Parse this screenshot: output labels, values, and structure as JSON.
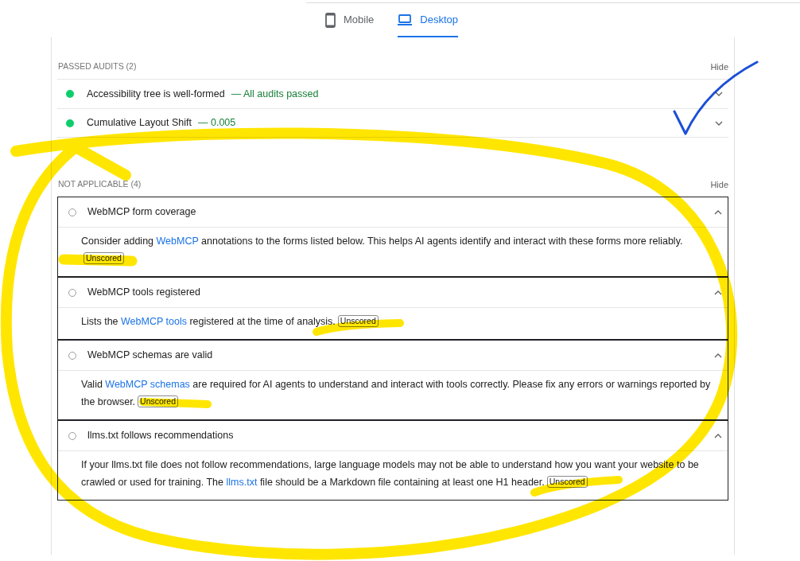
{
  "device_tabs": [
    {
      "label": "Mobile",
      "kind": "mobile",
      "selected": false
    },
    {
      "label": "Desktop",
      "kind": "desktop",
      "selected": true
    }
  ],
  "groups": [
    {
      "title": "PASSED AUDITS",
      "count": "(2)",
      "toggle": "Hide",
      "audits": [
        {
          "kind": "pass",
          "title": "Accessibility tree is well-formed",
          "display_value": "— All audits passed",
          "expanded": false
        },
        {
          "kind": "pass",
          "title": "Cumulative Layout Shift",
          "display_value": "— 0.005",
          "expanded": false
        }
      ]
    },
    {
      "title": "NOT APPLICABLE",
      "count": "(4)",
      "toggle": "Hide",
      "audits": [
        {
          "kind": "notapplicable",
          "title": "WebMCP form coverage",
          "expanded": true,
          "description": [
            {
              "kind": "text",
              "text": "Consider adding "
            },
            {
              "kind": "link",
              "text": "WebMCP"
            },
            {
              "kind": "text",
              "text": " annotations to the forms listed below. This helps AI agents identify and interact with these forms more reliably."
            }
          ],
          "badge": "Unscored"
        },
        {
          "kind": "notapplicable",
          "title": "WebMCP tools registered",
          "expanded": true,
          "description": [
            {
              "kind": "text",
              "text": "Lists the "
            },
            {
              "kind": "link",
              "text": "WebMCP tools"
            },
            {
              "kind": "text",
              "text": " registered at the time of analysis."
            }
          ],
          "badge": "Unscored"
        },
        {
          "kind": "notapplicable",
          "title": "WebMCP schemas are valid",
          "expanded": true,
          "description": [
            {
              "kind": "text",
              "text": "Valid "
            },
            {
              "kind": "link",
              "text": "WebMCP schemas"
            },
            {
              "kind": "text",
              "text": " are required for AI agents to understand and interact with tools correctly. Please fix any errors or warnings reported by the browser."
            }
          ],
          "badge": "Unscored"
        },
        {
          "kind": "notapplicable",
          "title": "llms.txt follows recommendations",
          "expanded": true,
          "description": [
            {
              "kind": "text",
              "text": "If your llms.txt file does not follow recommendations, large language models may not be able to understand how you want your website to be crawled or used for training. The "
            },
            {
              "kind": "link",
              "text": "llms.txt"
            },
            {
              "kind": "text",
              "text": " file should be a Markdown file containing at least one H1 header."
            }
          ],
          "badge": "Unscored"
        }
      ]
    }
  ]
}
